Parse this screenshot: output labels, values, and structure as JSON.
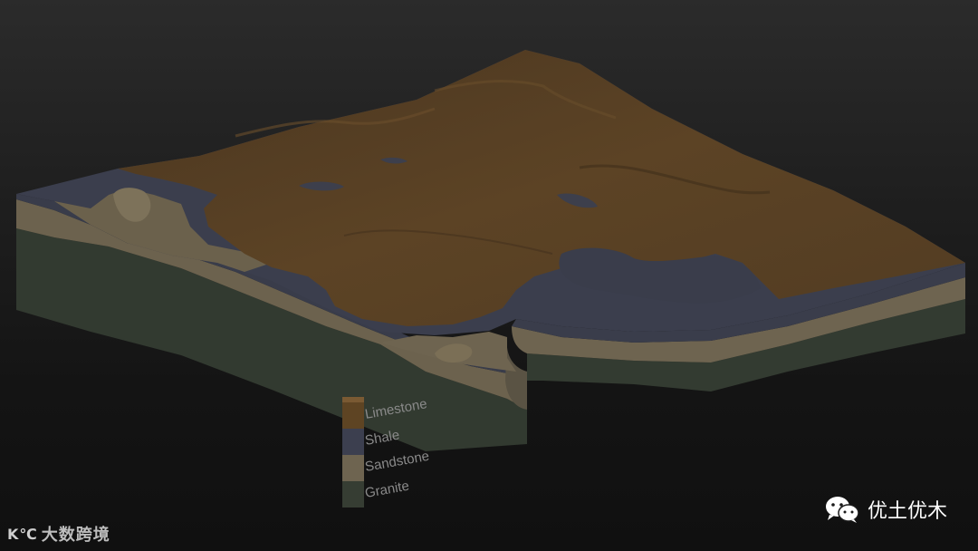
{
  "diagram": {
    "legend": {
      "layers": [
        {
          "name": "Limestone",
          "color": "#5e4423"
        },
        {
          "name": "Shale",
          "color": "#3c3f4f"
        },
        {
          "name": "Sandstone",
          "color": "#6e6450"
        },
        {
          "name": "Granite",
          "color": "#363d33"
        }
      ]
    },
    "colors": {
      "limestone_top": "#5a4226",
      "shale": "#3b3e4d",
      "sandstone": "#6f6550",
      "granite": "#333b31"
    }
  },
  "watermarks": {
    "left_text": "大数跨境",
    "left_logo": "K℃",
    "right_text": "优土优木",
    "right_icon": "wechat-icon"
  }
}
